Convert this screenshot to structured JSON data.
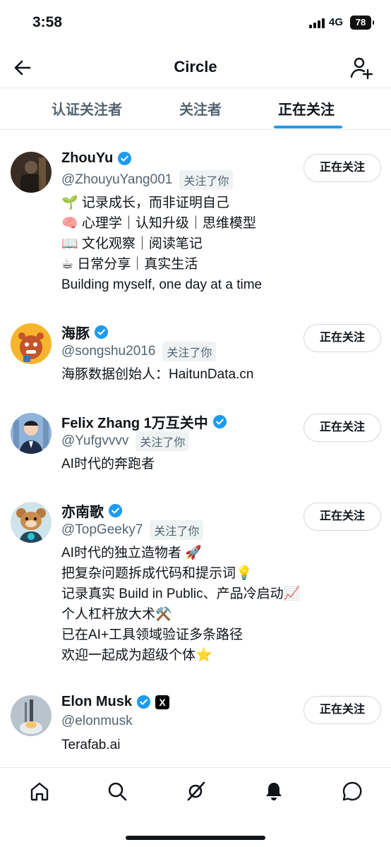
{
  "status_bar": {
    "time": "3:58",
    "network": "4G",
    "battery": "78"
  },
  "header": {
    "title": "Circle"
  },
  "tabs": [
    {
      "label": "认证关注者"
    },
    {
      "label": "关注者"
    },
    {
      "label": "正在关注"
    }
  ],
  "users": [
    {
      "name": "ZhouYu",
      "handle": "@ZhouyuYang001",
      "follows_you": "关注了你",
      "bio": [
        "🌱 记录成长，而非证明自己",
        "🧠 心理学｜认知升级｜思维模型",
        "📖 文化观察｜阅读笔记",
        "☕ 日常分享｜真实生活",
        "Building myself, one day at a time"
      ],
      "button": "正在关注"
    },
    {
      "name": "海豚",
      "handle": "@songshu2016",
      "follows_you": "关注了你",
      "bio": [
        "海豚数据创始人：HaitunData.cn"
      ],
      "button": "正在关注"
    },
    {
      "name": "Felix Zhang 1万互关中",
      "handle": "@Yufgvvvv",
      "follows_you": "关注了你",
      "bio": [
        "AI时代的奔跑者"
      ],
      "button": "正在关注"
    },
    {
      "name": "亦南歌",
      "handle": "@TopGeeky7",
      "follows_you": "关注了你",
      "bio": [
        "AI时代的独立造物者 🚀",
        "把复杂问题拆成代码和提示词💡",
        "记录真实 Build in Public、产品冷启动📈",
        "个人杠杆放大术⚒️",
        "已在AI+工具领域验证多条路径",
        "欢迎一起成为超级个体⭐"
      ],
      "button": "正在关注"
    },
    {
      "name": "Elon Musk",
      "handle": "@elonmusk",
      "affiliate_badge": "X",
      "bio": [
        "Terafab.ai"
      ],
      "button": "正在关注"
    }
  ],
  "colors": {
    "accent": "#1d9bf0",
    "text": "#0f1419",
    "secondary": "#536471"
  },
  "nav_icons": [
    "home-icon",
    "search-icon",
    "grok-icon",
    "notifications-icon",
    "messages-icon"
  ]
}
